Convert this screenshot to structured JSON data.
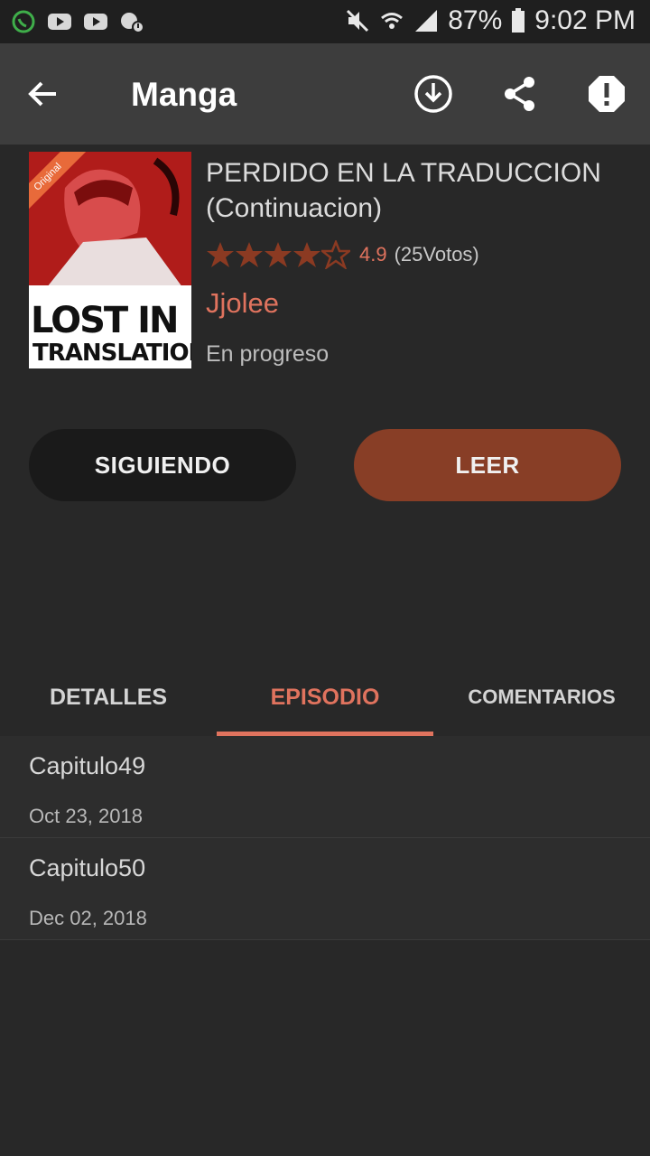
{
  "status_bar": {
    "battery": "87%",
    "time": "9:02 PM",
    "icons": [
      "whatsapp-icon",
      "youtube-icon",
      "youtube-icon",
      "voicemail-icon",
      "mute-icon",
      "wifi-icon",
      "signal-icon",
      "battery-icon"
    ]
  },
  "toolbar": {
    "title": "Manga",
    "icons": [
      "back-arrow-icon",
      "download-icon",
      "share-icon",
      "report-icon"
    ]
  },
  "manga": {
    "cover_badge": "Original",
    "cover_line1": "LOST IN",
    "cover_line2": "TRANSLATION",
    "title_line1": "PERDIDO EN LA TRADUCCION",
    "title_line2": "(Continuacion)",
    "rating_value": "4.9",
    "rating_votes": "(25Votos)",
    "rating_stars": 4,
    "author": "Jjolee",
    "status": "En progreso"
  },
  "actions": {
    "follow_label": "SIGUIENDO",
    "read_label": "LEER"
  },
  "tabs": [
    {
      "label": "DETALLES"
    },
    {
      "label": "EPISODIO"
    },
    {
      "label": "COMENTARIOS"
    }
  ],
  "active_tab": "EPISODIO",
  "episodes": [
    {
      "title": "Capitulo49",
      "date": "Oct 23, 2018"
    },
    {
      "title": "Capitulo50",
      "date": "Dec 02, 2018"
    }
  ],
  "colors": {
    "accent": "#e0735e",
    "read_button": "#883e26",
    "background": "#282828"
  }
}
